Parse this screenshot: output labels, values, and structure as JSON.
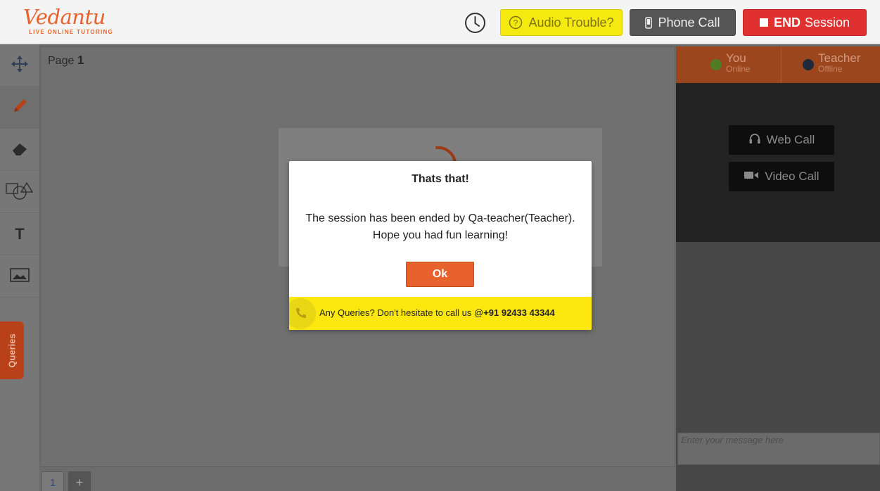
{
  "header": {
    "logo_text": "Vedantu",
    "logo_tagline": "LIVE ONLINE TUTORING",
    "audio_button_label": "Audio Trouble?",
    "phone_button_label": "Phone Call",
    "end_button_bold": "END",
    "end_button_label": "Session"
  },
  "toolbar": {
    "tools": [
      "move-icon",
      "pencil-icon",
      "eraser-icon",
      "shapes-icon",
      "text-icon",
      "image-icon"
    ],
    "text_tool_glyph": "T",
    "queries_label": "Queries"
  },
  "canvas": {
    "page_prefix": "Page",
    "page_number": "1",
    "page_tabs": [
      "1",
      "+"
    ]
  },
  "right_panel": {
    "you_name": "You",
    "you_status": "Online",
    "teacher_name": "Teacher",
    "teacher_status": "Offline",
    "web_call_label": "Web Call",
    "video_call_label": "Video Call",
    "chat_placeholder": "Enter your message here"
  },
  "modal": {
    "title": "Thats that!",
    "message_line1": "The session has been ended by Qa-teacher(Teacher).",
    "message_line2": "Hope you had fun learning!",
    "ok_label": "Ok",
    "footer_text": "Any Queries? Don't hesitate to call us @",
    "footer_phone": "+91 92433 43344"
  },
  "colors": {
    "brand_orange": "#e8622d",
    "audio_yellow": "#f4ea10",
    "end_red": "#e0302f",
    "footer_yellow": "#fce80f"
  }
}
